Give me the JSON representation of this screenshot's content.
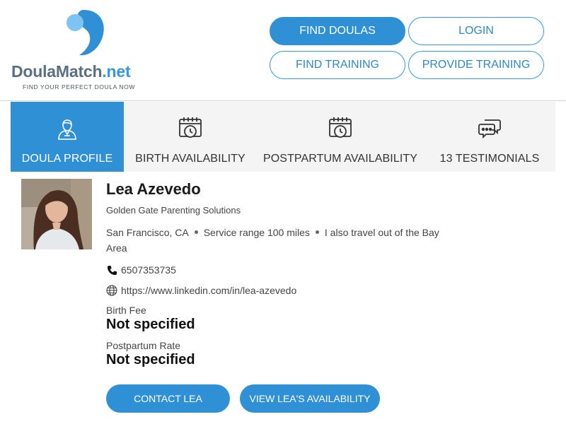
{
  "brand": {
    "name_part1": "Doula",
    "name_part2": "Match",
    "name_part3": ".net",
    "tagline": "FIND YOUR PERFECT DOULA NOW",
    "accent_color": "#2f90d6"
  },
  "nav": {
    "find_doulas": "FIND DOULAS",
    "login": "LOGIN",
    "find_training": "FIND TRAINING",
    "provide_training": "PROVIDE TRAINING"
  },
  "tabs": [
    {
      "label": "DOULA PROFILE",
      "icon": "doula-person-icon",
      "active": true
    },
    {
      "label": "BIRTH AVAILABILITY",
      "icon": "calendar-clock-icon",
      "active": false
    },
    {
      "label": "POSTPARTUM AVAILABILITY",
      "icon": "calendar-clock-icon",
      "active": false
    },
    {
      "label": "13 TESTIMONIALS",
      "icon": "chat-bubbles-icon",
      "active": false
    }
  ],
  "profile": {
    "name": "Lea Azevedo",
    "organization": "Golden Gate Parenting Solutions",
    "city": "San Francisco, CA",
    "service_range": "Service range 100 miles",
    "travel": "I also travel out of the Bay Area",
    "phone": "6507353735",
    "website": "https://www.linkedin.com/in/lea-azevedo",
    "birth_fee_label": "Birth Fee",
    "birth_fee_value": "Not specified",
    "postpartum_rate_label": "Postpartum Rate",
    "postpartum_rate_value": "Not specified"
  },
  "actions": {
    "contact": "CONTACT LEA",
    "availability": "VIEW LEA'S AVAILABILITY"
  }
}
